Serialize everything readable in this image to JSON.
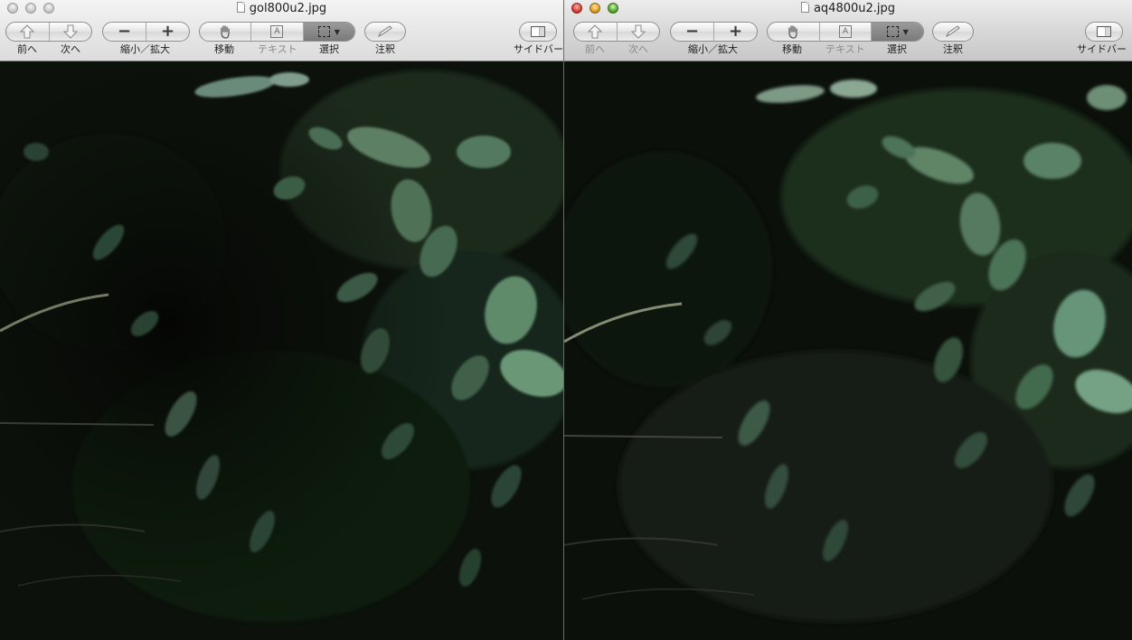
{
  "windows": {
    "left": {
      "title": "gol800u2.jpg",
      "state": "inactive",
      "toolbar": {
        "back_label": "前へ",
        "next_label": "次へ",
        "zoom_label": "縮小／拡大",
        "move_label": "移動",
        "text_label": "テキスト",
        "select_label": "選択",
        "annotate_label": "注釈",
        "sidebar_label": "サイドバー"
      }
    },
    "right": {
      "title": "aq4800u2.jpg",
      "state": "active",
      "toolbar": {
        "back_label": "前へ",
        "next_label": "次へ",
        "zoom_label": "縮小／拡大",
        "move_label": "移動",
        "text_label": "テキスト",
        "select_label": "選択",
        "annotate_label": "注釈",
        "sidebar_label": "サイドバー"
      }
    }
  },
  "icons": {
    "back": "arrow-up-icon",
    "next": "arrow-down-icon",
    "zoom_out": "minus-icon",
    "zoom_in": "plus-icon",
    "move": "hand-icon",
    "text": "text-cursor-icon",
    "select": "rect-select-icon",
    "annotate": "pencil-icon",
    "sidebar": "sidebar-icon"
  },
  "colors": {
    "toolbar_bg": "#d8d8d8",
    "close_red": "#e0443a",
    "minimize_yellow": "#e6a524",
    "zoom_green": "#5bb136",
    "photo_dark": "#0a0d08",
    "leaf_green": "#3f6a4a"
  }
}
